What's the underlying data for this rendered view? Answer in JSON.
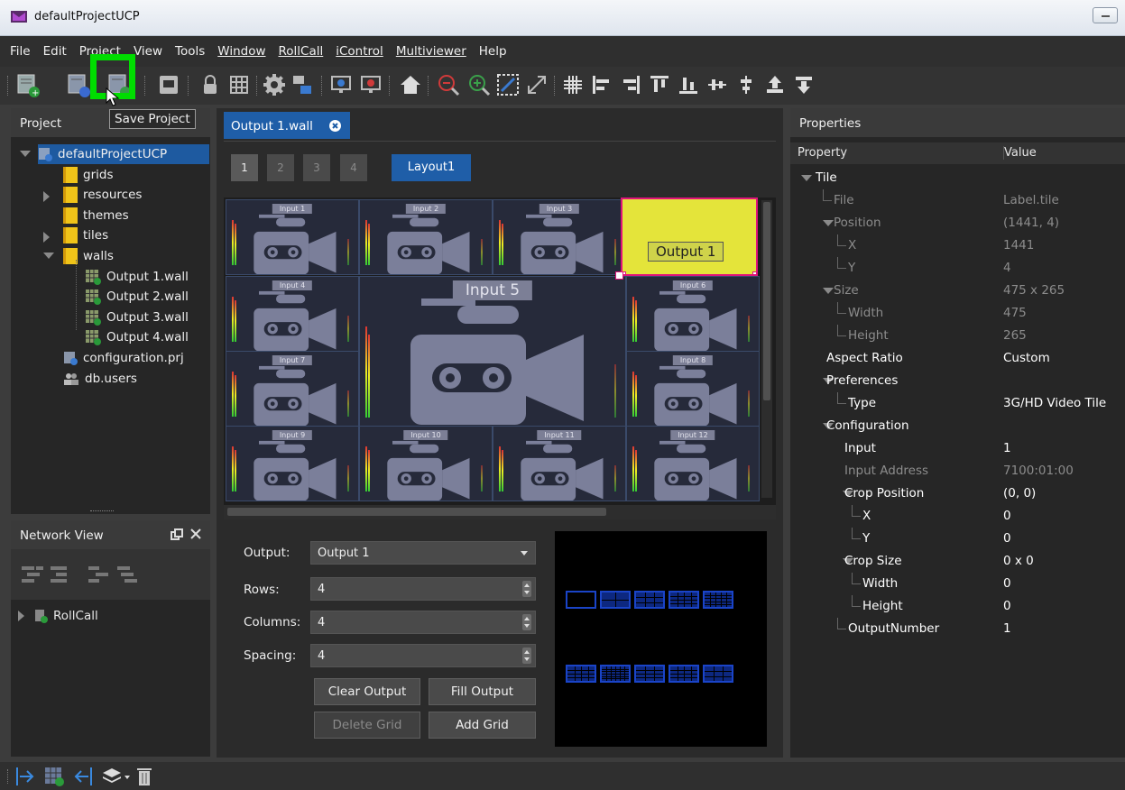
{
  "window": {
    "title": "defaultProjectUCP"
  },
  "menu": [
    "File",
    "Edit",
    "Project",
    "View",
    "Tools",
    "Window",
    "RollCall",
    "iControl",
    "Multiviewer",
    "Help"
  ],
  "toolbar": {
    "tooltip": "Save Project",
    "highlight_color": "#00dd00"
  },
  "project_panel": {
    "title": "Project",
    "tree": [
      {
        "label": "defaultProjectUCP",
        "depth": 0,
        "expanded": true,
        "selected": true,
        "icon": "project-icon"
      },
      {
        "label": "grids",
        "depth": 1,
        "icon": "folder-icon"
      },
      {
        "label": "resources",
        "depth": 1,
        "icon": "folder-icon",
        "collapsed": true
      },
      {
        "label": "themes",
        "depth": 1,
        "icon": "folder-icon"
      },
      {
        "label": "tiles",
        "depth": 1,
        "icon": "folder-icon",
        "collapsed": true
      },
      {
        "label": "walls",
        "depth": 1,
        "icon": "folder-icon",
        "expanded": true
      },
      {
        "label": "Output 1.wall",
        "depth": 2,
        "icon": "wall-icon"
      },
      {
        "label": "Output 2.wall",
        "depth": 2,
        "icon": "wall-icon"
      },
      {
        "label": "Output 3.wall",
        "depth": 2,
        "icon": "wall-icon"
      },
      {
        "label": "Output 4.wall",
        "depth": 2,
        "icon": "wall-icon"
      },
      {
        "label": "configuration.prj",
        "depth": 1,
        "icon": "config-icon"
      },
      {
        "label": "db.users",
        "depth": 1,
        "icon": "users-icon"
      }
    ]
  },
  "network_panel": {
    "title": "Network View",
    "items": [
      {
        "label": "RollCall",
        "icon": "rollcall-icon"
      }
    ]
  },
  "editor": {
    "tab_label": "Output 1.wall",
    "pages": [
      "1",
      "2",
      "3",
      "4"
    ],
    "layout_label": "Layout1",
    "tiles": [
      {
        "label": "Input 1"
      },
      {
        "label": "Input 2"
      },
      {
        "label": "Input 3"
      },
      {
        "label": "Output 1"
      },
      {
        "label": "Input 4"
      },
      {
        "label": "Input 5"
      },
      {
        "label": "Input 6"
      },
      {
        "label": "Input 7"
      },
      {
        "label": "Input 8"
      },
      {
        "label": "Input 9"
      },
      {
        "label": "Input 10"
      },
      {
        "label": "Input 11"
      },
      {
        "label": "Input 12"
      }
    ]
  },
  "form": {
    "output_label": "Output:",
    "output_value": "Output 1",
    "rows_label": "Rows:",
    "rows_value": "4",
    "columns_label": "Columns:",
    "columns_value": "4",
    "spacing_label": "Spacing:",
    "spacing_value": "4",
    "clear_output": "Clear Output",
    "fill_output": "Fill Output",
    "delete_grid": "Delete Grid",
    "add_grid": "Add Grid"
  },
  "properties": {
    "title": "Properties",
    "col_property": "Property",
    "col_value": "Value",
    "rows": [
      {
        "k": "Tile",
        "v": "",
        "style": "bold"
      },
      {
        "k": "File",
        "v": "Label.tile",
        "style": "dim"
      },
      {
        "k": "Position",
        "v": "(1441, 4)",
        "style": "dim"
      },
      {
        "k": "X",
        "v": "1441",
        "style": "dim"
      },
      {
        "k": "Y",
        "v": "4",
        "style": "dim"
      },
      {
        "k": "Size",
        "v": "475 x 265",
        "style": "dim"
      },
      {
        "k": "Width",
        "v": "475",
        "style": "dim"
      },
      {
        "k": "Height",
        "v": "265",
        "style": "dim"
      },
      {
        "k": "Aspect Ratio",
        "v": "Custom",
        "style": "bold"
      },
      {
        "k": "Preferences",
        "v": "",
        "style": "bold"
      },
      {
        "k": "Type",
        "v": "3G/HD Video Tile",
        "style": "bold"
      },
      {
        "k": "Configuration",
        "v": "",
        "style": "bold"
      },
      {
        "k": "Input",
        "v": "1",
        "style": "bold"
      },
      {
        "k": "Input Address",
        "v": "7100:01:00",
        "style": "dim"
      },
      {
        "k": "Crop Position",
        "v": "(0, 0)",
        "style": "bold"
      },
      {
        "k": "X",
        "v": "0",
        "style": "bold"
      },
      {
        "k": "Y",
        "v": "0",
        "style": "bold"
      },
      {
        "k": "Crop Size",
        "v": "0 x 0",
        "style": "bold"
      },
      {
        "k": "Width",
        "v": "0",
        "style": "bold"
      },
      {
        "k": "Height",
        "v": "0",
        "style": "bold"
      },
      {
        "k": "OutputNumber",
        "v": "1",
        "style": "bold"
      }
    ]
  }
}
